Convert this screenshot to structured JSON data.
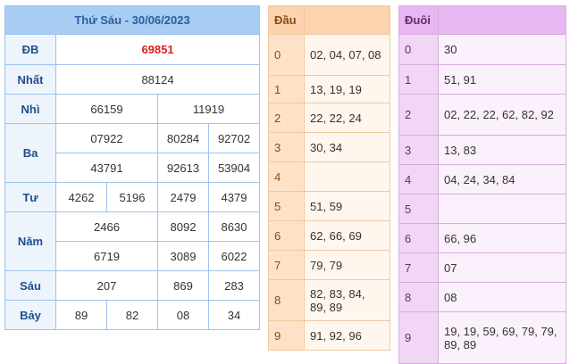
{
  "result": {
    "title": "Thứ Sáu - 30/06/2023",
    "rows": {
      "db": {
        "label": "ĐB",
        "values": [
          "69851"
        ]
      },
      "nhat": {
        "label": "Nhất",
        "values": [
          "88124"
        ]
      },
      "nhi": {
        "label": "Nhì",
        "values": [
          "66159",
          "11919"
        ]
      },
      "ba": {
        "label": "Ba",
        "values": [
          "07922",
          "80284",
          "92702",
          "43791",
          "92613",
          "53904"
        ]
      },
      "tu": {
        "label": "Tư",
        "values": [
          "4262",
          "5196",
          "2479",
          "4379"
        ]
      },
      "nam": {
        "label": "Năm",
        "values": [
          "2466",
          "8092",
          "8630",
          "6719",
          "3089",
          "6022"
        ]
      },
      "sau": {
        "label": "Sáu",
        "values": [
          "207",
          "869",
          "283"
        ]
      },
      "bay": {
        "label": "Bảy",
        "values": [
          "89",
          "82",
          "08",
          "34"
        ]
      }
    },
    "colors": {
      "special": "#e02020",
      "header": "#a9cdf2"
    }
  },
  "head": {
    "title": "Đầu",
    "rows": [
      {
        "key": "0",
        "vals": "02, 04, 07, 08"
      },
      {
        "key": "1",
        "vals": "13, 19, 19"
      },
      {
        "key": "2",
        "vals": "22, 22, 24"
      },
      {
        "key": "3",
        "vals": "30, 34"
      },
      {
        "key": "4",
        "vals": ""
      },
      {
        "key": "5",
        "vals": "51, 59"
      },
      {
        "key": "6",
        "vals": "62, 66, 69"
      },
      {
        "key": "7",
        "vals": "79, 79"
      },
      {
        "key": "8",
        "vals": "82, 83, 84, 89, 89"
      },
      {
        "key": "9",
        "vals": "91, 92, 96"
      }
    ],
    "colors": {
      "header": "#fcd3ae"
    }
  },
  "tail": {
    "title": "Đuôi",
    "rows": [
      {
        "key": "0",
        "vals": "30"
      },
      {
        "key": "1",
        "vals": "51, 91"
      },
      {
        "key": "2",
        "vals": "02, 22, 22, 62, 82, 92"
      },
      {
        "key": "3",
        "vals": "13, 83"
      },
      {
        "key": "4",
        "vals": "04, 24, 34, 84"
      },
      {
        "key": "5",
        "vals": ""
      },
      {
        "key": "6",
        "vals": "66, 96"
      },
      {
        "key": "7",
        "vals": "07"
      },
      {
        "key": "8",
        "vals": "08"
      },
      {
        "key": "9",
        "vals": "19, 19, 59, 69, 79, 79, 89, 89"
      }
    ],
    "colors": {
      "header": "#e8b6f0"
    }
  }
}
